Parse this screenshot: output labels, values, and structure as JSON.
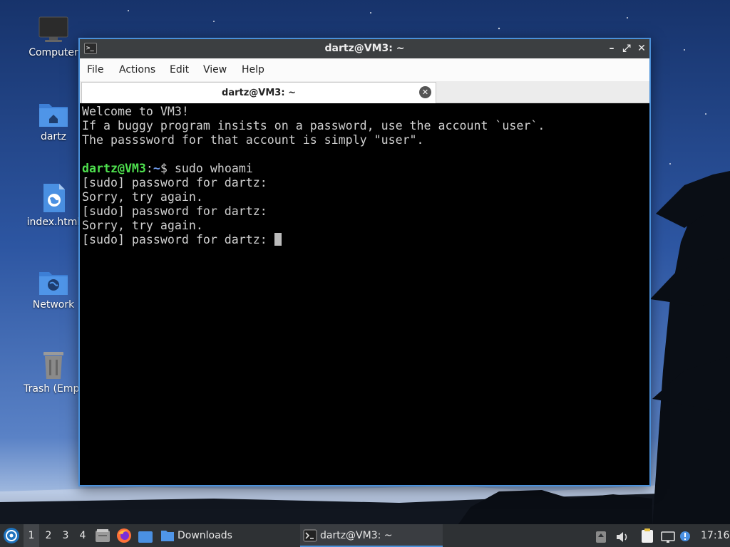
{
  "desktop": {
    "icons": [
      {
        "label": "Computer",
        "icon": "computer-icon"
      },
      {
        "label": "dartz",
        "icon": "home-folder-icon"
      },
      {
        "label": "index.html",
        "icon": "html-file-icon"
      },
      {
        "label": "Network",
        "icon": "network-folder-icon"
      },
      {
        "label": "Trash (Empt",
        "icon": "trash-icon"
      }
    ]
  },
  "window": {
    "title": "dartz@VM3: ~",
    "controls": {
      "minimize": "–",
      "maximize": "⤢",
      "close": "✕"
    },
    "menu": [
      "File",
      "Actions",
      "Edit",
      "View",
      "Help"
    ],
    "tab": {
      "title": "dartz@VM3: ~",
      "close": "✕"
    },
    "terminal": {
      "lines": [
        "Welcome to VM3!",
        "If a buggy program insists on a password, use the account `user`.",
        "The passsword for that account is simply \"user\".",
        ""
      ],
      "prompt": {
        "user_host": "dartz@VM3",
        "sep": ":",
        "path": "~",
        "symbol": "$ ",
        "command": "sudo whoami"
      },
      "output": [
        "[sudo] password for dartz:",
        "Sorry, try again.",
        "[sudo] password for dartz:",
        "Sorry, try again."
      ],
      "current": "[sudo] password for dartz: "
    }
  },
  "taskbar": {
    "workspaces": [
      "1",
      "2",
      "3",
      "4"
    ],
    "active_workspace": "1",
    "tasks": [
      {
        "label": "Downloads",
        "icon": "folder-icon"
      },
      {
        "label": "dartz@VM3: ~",
        "icon": "terminal-icon"
      }
    ],
    "clock": "17:16"
  },
  "colors": {
    "accent": "#4a90d9",
    "prompt_user": "#4ee04e",
    "prompt_path": "#6f9cf0"
  }
}
